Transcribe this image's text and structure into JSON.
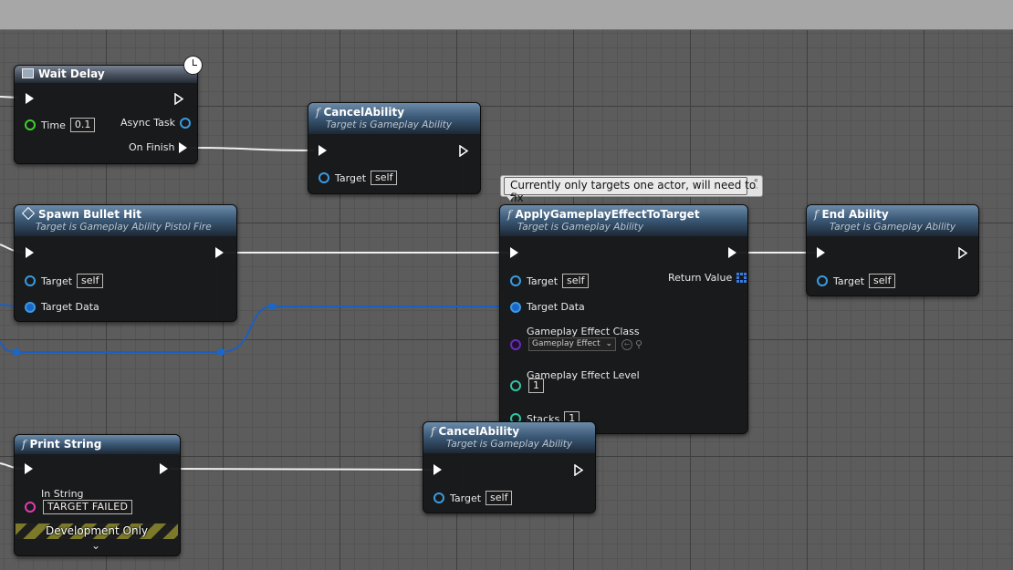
{
  "colors": {
    "exec": "#ffffff",
    "object_pin": "#3a9be0",
    "data_wire": "#1b5fbf",
    "float_pin": "#3fd12a",
    "int_pin": "#2ec6a4",
    "string_pin": "#e33bb1",
    "class_pin": "#6b2bbd"
  },
  "nodes": {
    "wait_delay": {
      "title": "Wait Delay",
      "icon": "window-icon",
      "time_label": "Time",
      "time_value": "0.1",
      "async_label": "Async Task",
      "finish_label": "On Finish",
      "badge_icon": "clock-icon"
    },
    "cancel_1": {
      "title": "CancelAbility",
      "subtitle": "Target is Gameplay Ability",
      "target_label": "Target",
      "target_value": "self"
    },
    "spawn_bullet": {
      "title": "Spawn Bullet Hit",
      "subtitle": "Target is Gameplay Ability Pistol Fire",
      "target_label": "Target",
      "target_value": "self",
      "data_label": "Target Data"
    },
    "apply_effect": {
      "title": "ApplyGameplayEffectToTarget",
      "subtitle": "Target is Gameplay Ability",
      "target_label": "Target",
      "target_value": "self",
      "return_label": "Return Value",
      "data_label": "Target Data",
      "class_label": "Gameplay Effect Class",
      "class_value": "Gameplay Effect",
      "level_label": "Gameplay Effect Level",
      "level_value": "1",
      "stacks_label": "Stacks",
      "stacks_value": "1"
    },
    "end_ability": {
      "title": "End Ability",
      "subtitle": "Target is Gameplay Ability",
      "target_label": "Target",
      "target_value": "self"
    },
    "print_string": {
      "title": "Print String",
      "instring_label": "In String",
      "instring_value": "TARGET FAILED",
      "dev_label": "Development Only"
    },
    "cancel_2": {
      "title": "CancelAbility",
      "subtitle": "Target is Gameplay Ability",
      "target_label": "Target",
      "target_value": "self"
    }
  },
  "comment": {
    "text": "Currently only targets one actor, will need to fix"
  }
}
